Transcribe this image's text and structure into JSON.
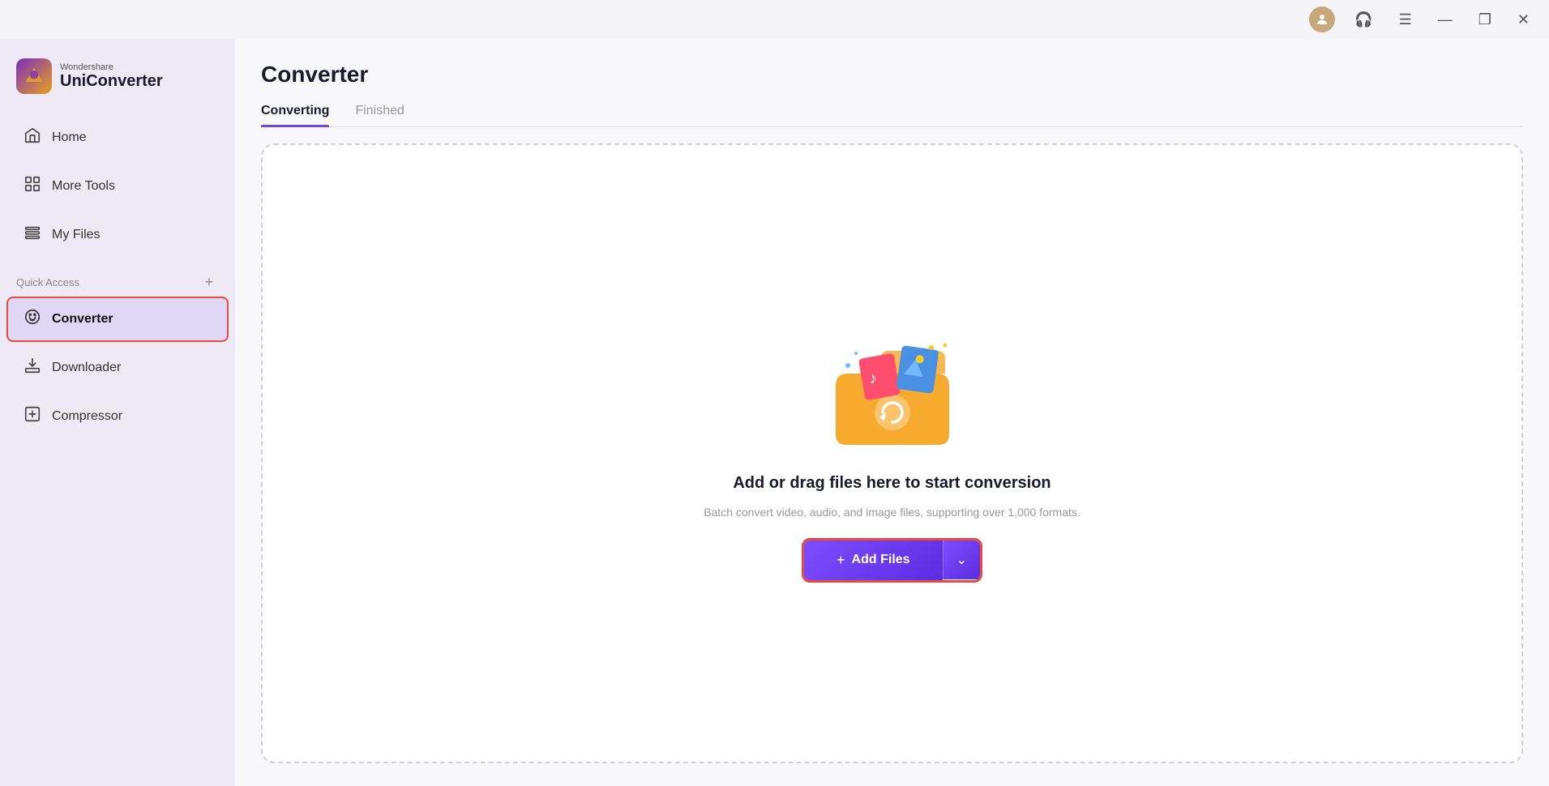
{
  "titlebar": {
    "minimize_label": "—",
    "restore_label": "❐",
    "close_label": "✕"
  },
  "logo": {
    "brand": "Wondershare",
    "app_name": "UniConverter"
  },
  "sidebar": {
    "nav_items": [
      {
        "id": "home",
        "label": "Home",
        "icon": "⌂",
        "active": false
      },
      {
        "id": "more-tools",
        "label": "More Tools",
        "icon": "⊞",
        "active": false
      },
      {
        "id": "my-files",
        "label": "My Files",
        "icon": "☰",
        "active": false
      }
    ],
    "quick_access_label": "Quick Access",
    "add_button_label": "+",
    "quick_access_items": [
      {
        "id": "converter",
        "label": "Converter",
        "icon": "⟳",
        "active": true
      },
      {
        "id": "downloader",
        "label": "Downloader",
        "icon": "⬇",
        "active": false
      },
      {
        "id": "compressor",
        "label": "Compressor",
        "icon": "⬛",
        "active": false
      }
    ]
  },
  "main": {
    "page_title": "Converter",
    "tabs": [
      {
        "id": "converting",
        "label": "Converting",
        "active": true
      },
      {
        "id": "finished",
        "label": "Finished",
        "active": false
      }
    ],
    "drop_zone": {
      "title": "Add or drag files here to start conversion",
      "subtitle": "Batch convert video, audio, and image files, supporting over 1,000 formats.",
      "add_files_label": "+ Add Files",
      "add_files_plus": "+",
      "add_files_text": "Add Files"
    }
  }
}
